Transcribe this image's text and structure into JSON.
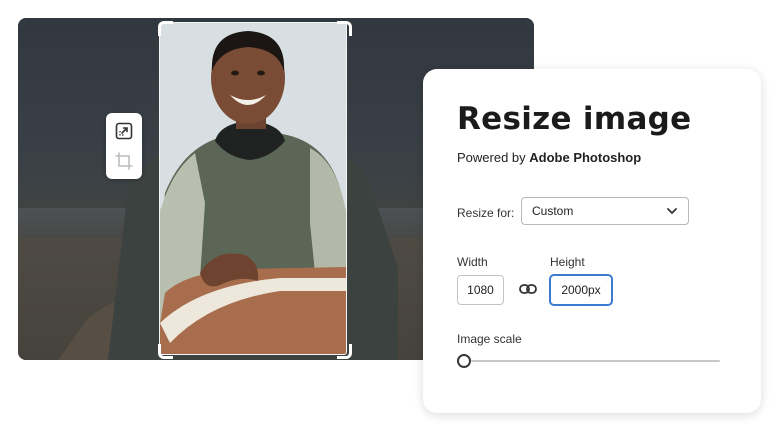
{
  "panel": {
    "title": "Resize image",
    "powered_prefix": "Powered by ",
    "powered_brand": "Adobe Photoshop",
    "resize_for": {
      "label": "Resize for:",
      "selected": "Custom"
    },
    "width": {
      "label": "Width",
      "value": "1080"
    },
    "height": {
      "label": "Height",
      "value": "2000px"
    },
    "image_scale": {
      "label": "Image scale",
      "value": 0
    }
  },
  "toolbar": {
    "tools": [
      {
        "icon": "resize-icon"
      },
      {
        "icon": "crop-icon"
      }
    ]
  },
  "colors": {
    "accent": "#3b7bd1",
    "title_text": "#1b1b1b"
  },
  "icons": {
    "dropdown": "chevron-down-icon",
    "link": "link-icon"
  }
}
